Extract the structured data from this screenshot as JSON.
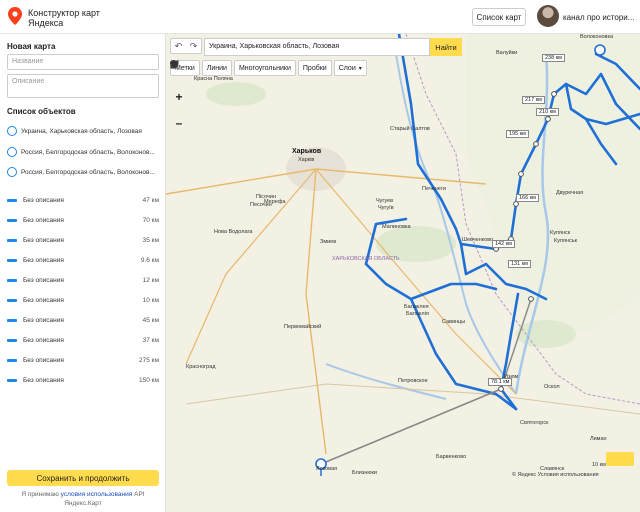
{
  "header": {
    "app_title_line1": "Конструктор карт",
    "app_title_line2": "Яндекса",
    "scheme_button": "Список карт",
    "channel_label": "канал про истори..."
  },
  "sidebar": {
    "title": "Новая карта",
    "name_placeholder": "Название",
    "description_placeholder": "Описание",
    "list_title": "Список объектов",
    "points": [
      {
        "label": "Украина, Харьковская область, Лозовая"
      },
      {
        "label": "Россия, Белгородская область, Волоконов..."
      },
      {
        "label": "Россия, Белгородская область, Волоконов..."
      }
    ],
    "lines": [
      {
        "label": "Без описания",
        "distance": "47 км"
      },
      {
        "label": "Без описания",
        "distance": "70 км"
      },
      {
        "label": "Без описания",
        "distance": "35 км"
      },
      {
        "label": "Без описания",
        "distance": "9.6 км"
      },
      {
        "label": "Без описания",
        "distance": "12 км"
      },
      {
        "label": "Без описания",
        "distance": "10 км"
      },
      {
        "label": "Без описания",
        "distance": "45 км"
      },
      {
        "label": "Без описания",
        "distance": "37 км"
      },
      {
        "label": "Без описания",
        "distance": "275 км"
      },
      {
        "label": "Без описания",
        "distance": "150 км"
      }
    ],
    "save_button": "Сохранить и продолжить",
    "terms_prefix": "Я принимаю ",
    "terms_link": "условия использования",
    "terms_suffix": " API Яндекс.Карт"
  },
  "map": {
    "undo_icon": "undo-icon",
    "redo_icon": "redo-icon",
    "search_value": "Украина, Харьковская область, Лозовая",
    "search_button": "Найти",
    "tools": {
      "marks": "Метки",
      "lines": "Линии",
      "polygons": "Многоугольники",
      "traffic": "Пробки",
      "layers": "Слои"
    },
    "zoom_in": "+",
    "zoom_out": "–",
    "cities": {
      "kharkov": "Харьков",
      "kharkov_ua": "Харків"
    },
    "labels": {
      "l1": "Красна Поляна",
      "l2": "Стрелечья",
      "l3": "Пісочин",
      "l4": "Песочин",
      "l5": "Мерефа",
      "l6": "Нова Водолага",
      "l7": "Змиев",
      "l8": "Чугуев",
      "l9": "Чугуїв",
      "l10": "Малиновка",
      "l11": "Балаклея",
      "l12": "Балаклія",
      "l13": "Савинцы",
      "l14": "Изюм",
      "l15": "Ізюм",
      "l16": "Лозовая",
      "l17": "Близнюки",
      "l18": "Барвенково",
      "l19": "Святогорск",
      "l20": "Лиман",
      "l21": "Славянск",
      "l22": "Купянск",
      "l23": "Купянськ",
      "l24": "Двуречная",
      "l25": "Валуйки",
      "l26": "Волоконовка",
      "l27": "Шевченково",
      "l28": "Первомайский",
      "l29": "Красноград",
      "l30": "Печенеги",
      "l31": "Старый Салтов",
      "l32": "ХАРЬКОВСКАЯ ОБЛАСТЬ",
      "l33": "Оскол",
      "l34": "Красный Лиман",
      "l35": "Петровское",
      "l36": "Сватове"
    },
    "distance_labels": {
      "d1": "238 км",
      "d2": "217 км",
      "d3": "210 км",
      "d4": "195 км",
      "d5": "166 км",
      "d6": "142 км",
      "d7": "131 км",
      "d8": "78.1 км"
    },
    "copyright": "© Яндекс Условия использования",
    "scale": "10 км"
  }
}
